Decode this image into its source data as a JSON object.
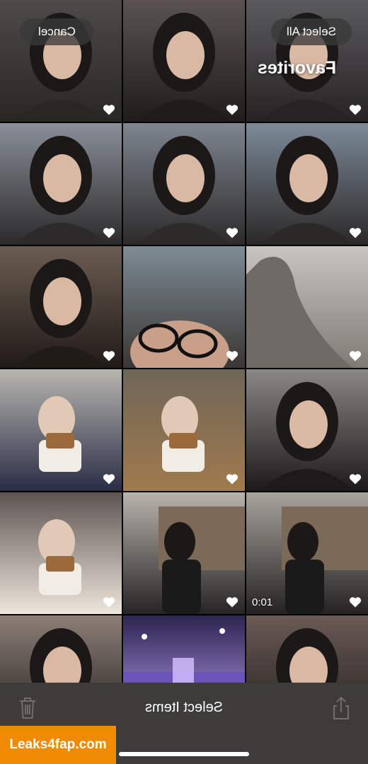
{
  "header": {
    "cancel_label": "Cancel",
    "select_all_label": "Select All",
    "title": "Favorites"
  },
  "grid": {
    "tiles": [
      {
        "kind": "selfie",
        "base": "#4e4a49",
        "accent": "#2a2624",
        "favorite": true
      },
      {
        "kind": "selfie",
        "base": "#5a5352",
        "accent": "#1f1c1b",
        "favorite": true
      },
      {
        "kind": "selfie",
        "base": "#5b5a5d",
        "accent": "#262324",
        "favorite": true
      },
      {
        "kind": "selfie",
        "base": "#8a8f99",
        "accent": "#2c2a2b",
        "favorite": true
      },
      {
        "kind": "selfie",
        "base": "#7e8690",
        "accent": "#2d2a2a",
        "favorite": true
      },
      {
        "kind": "selfie",
        "base": "#7c8a98",
        "accent": "#2b2828",
        "favorite": true
      },
      {
        "kind": "selfie",
        "base": "#6b5c51",
        "accent": "#211b18",
        "favorite": true
      },
      {
        "kind": "glasses",
        "base": "#7d8c94",
        "accent": "#3b3633",
        "favorite": true
      },
      {
        "kind": "statue",
        "base": "#c8c4c0",
        "accent": "#807a74",
        "favorite": true
      },
      {
        "kind": "food",
        "base": "#b8b6b0",
        "accent": "#2a2d46",
        "favorite": true
      },
      {
        "kind": "food",
        "base": "#6f6657",
        "accent": "#a07a4e",
        "favorite": true
      },
      {
        "kind": "selfie",
        "base": "#8a8886",
        "accent": "#1c1a1a",
        "favorite": true
      },
      {
        "kind": "food",
        "base": "#5d5552",
        "accent": "#ece6dc",
        "favorite": true
      },
      {
        "kind": "street",
        "base": "#b9b3ac",
        "accent": "#262424",
        "favorite": true
      },
      {
        "kind": "street",
        "base": "#a9a39d",
        "accent": "#242222",
        "favorite": true,
        "duration": "0:01"
      },
      {
        "kind": "selfie",
        "base": "#8d7f77",
        "accent": "#1e1b1b",
        "favorite": false
      },
      {
        "kind": "concert",
        "base": "#2c2550",
        "accent": "#c8a9ff",
        "favorite": false
      },
      {
        "kind": "selfie",
        "base": "#6b5a54",
        "accent": "#1e1b1b",
        "favorite": false
      }
    ]
  },
  "toolbar": {
    "label": "Select Items",
    "trash_icon": "trash-icon",
    "share_icon": "share-icon"
  },
  "watermark": {
    "text": "Leaks4fap.com",
    "color": "#f08a00"
  }
}
